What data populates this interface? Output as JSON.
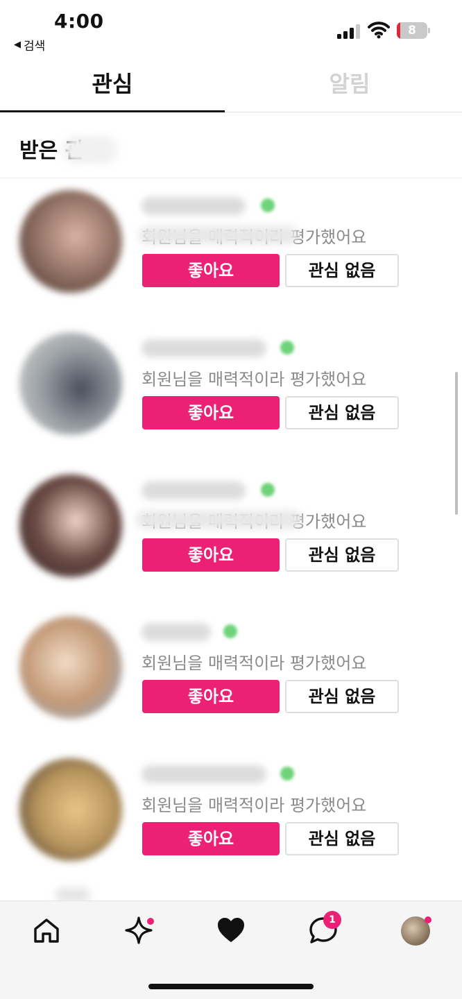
{
  "status_bar": {
    "time": "4:00",
    "back_label": "검색",
    "battery_level": "8"
  },
  "tabs": [
    {
      "label": "관심",
      "active": true
    },
    {
      "label": "알림",
      "active": false
    }
  ],
  "section": {
    "title": "받은 관"
  },
  "interests": {
    "message_suffix": "평가했어요",
    "full_message": "회원님을 매력적이라 평가했어요",
    "partial_message_4": "회원님을 매력적이라 평가했어요",
    "like_label": "좋아요",
    "pass_label": "관심 없음"
  },
  "bottom_nav": {
    "chat_badge": "1",
    "items": [
      "home-icon",
      "sparkle-icon",
      "heart-icon",
      "chat-icon",
      "profile-avatar"
    ]
  },
  "colors": {
    "accent": "#ec2176",
    "online": "#6fd37a"
  }
}
